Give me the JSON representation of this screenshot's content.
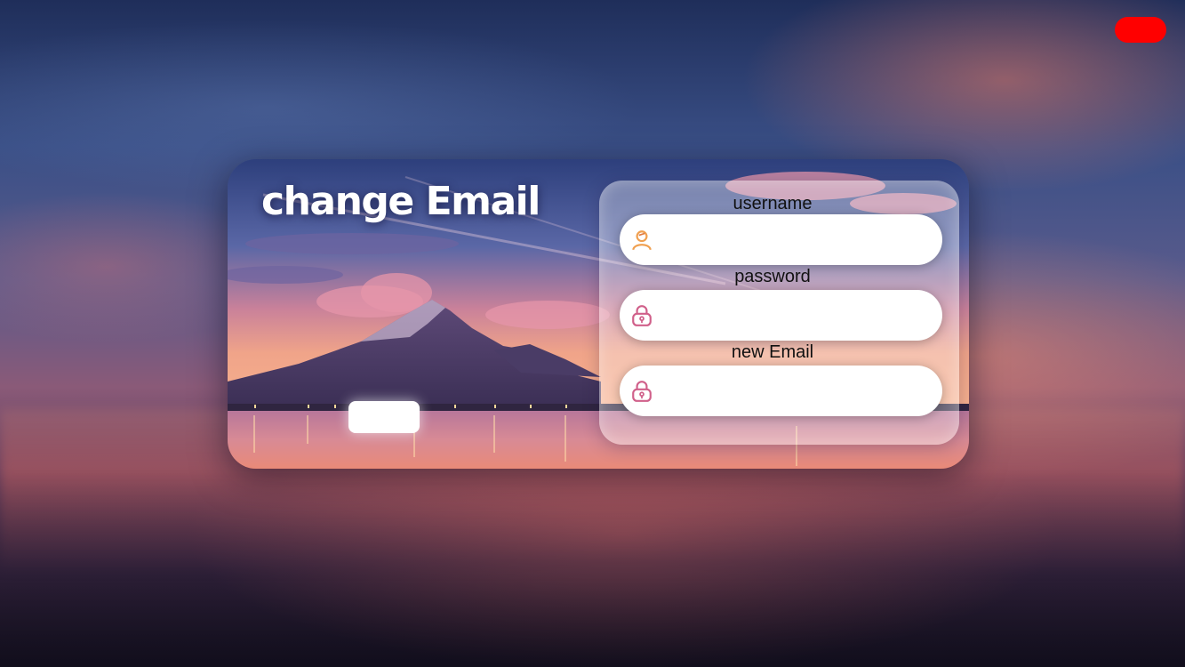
{
  "window": {
    "close_color": "#ff0000"
  },
  "card": {
    "title": "change Email",
    "submit_label": ""
  },
  "form": {
    "fields": [
      {
        "label": "username",
        "value": "",
        "placeholder": "",
        "icon": "user-icon"
      },
      {
        "label": "password",
        "value": "",
        "placeholder": "",
        "icon": "lock-icon"
      },
      {
        "label": "new Email",
        "value": "",
        "placeholder": "",
        "icon": "lock-icon"
      }
    ]
  }
}
